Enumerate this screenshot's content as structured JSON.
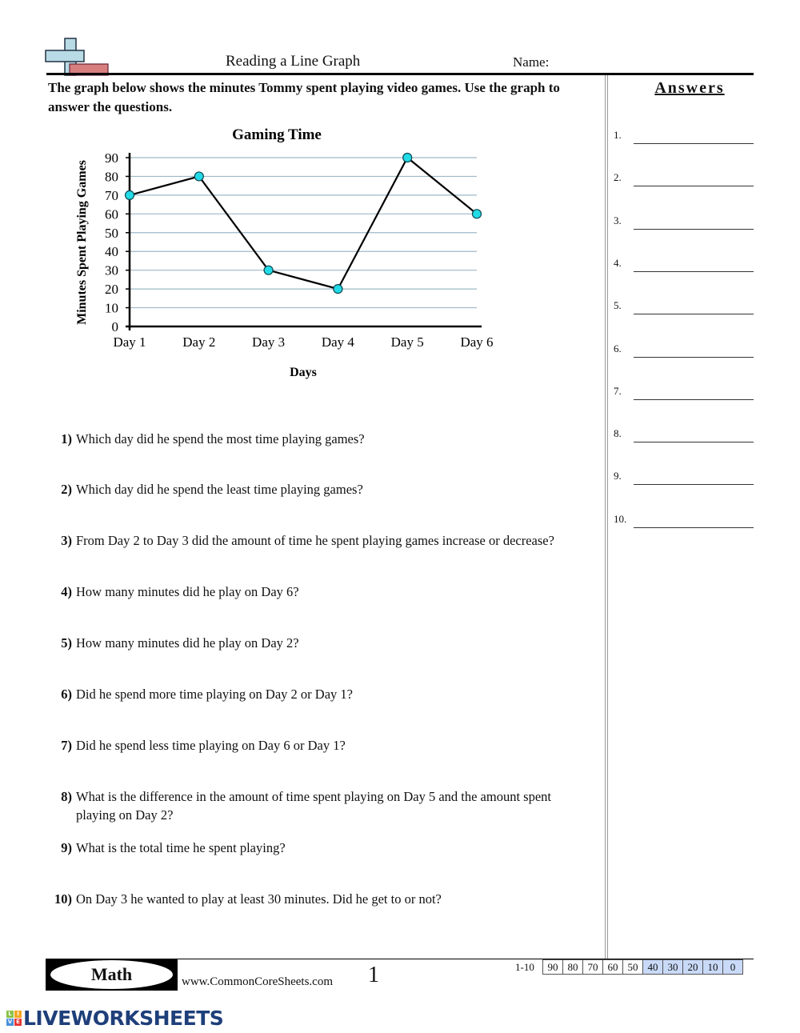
{
  "header": {
    "title": "Reading a Line Graph",
    "name_label": "Name:",
    "instructions": "The graph below shows the minutes Tommy spent playing video games. Use the graph to answer the questions."
  },
  "chart_data": {
    "type": "line",
    "title": "Gaming Time",
    "xlabel": "Days",
    "ylabel": "Minutes Spent Playing Games",
    "categories": [
      "Day 1",
      "Day 2",
      "Day 3",
      "Day 4",
      "Day 5",
      "Day 6"
    ],
    "series": [
      {
        "name": "Minutes",
        "values": [
          70,
          80,
          30,
          20,
          90,
          60
        ]
      }
    ],
    "ylim": [
      0,
      90
    ],
    "yticks": [
      0,
      10,
      20,
      30,
      40,
      50,
      60,
      70,
      80,
      90
    ],
    "grid": true,
    "legend": "none",
    "colors": {
      "marker": "#22dbe6",
      "line": "#000000",
      "grid": "#9fb8c8"
    }
  },
  "questions": [
    {
      "num": "1)",
      "text": "Which day did he spend the most time playing games?"
    },
    {
      "num": "2)",
      "text": "Which day did he spend the least time playing games?"
    },
    {
      "num": "3)",
      "text": "From Day 2 to Day 3 did the amount of time he spent playing games increase or decrease?"
    },
    {
      "num": "4)",
      "text": "How many minutes did he play on Day 6?"
    },
    {
      "num": "5)",
      "text": "How many minutes did he play on Day 2?"
    },
    {
      "num": "6)",
      "text": "Did he spend more time playing on Day 2 or Day 1?"
    },
    {
      "num": "7)",
      "text": "Did he spend less time playing on Day 6 or Day 1?"
    },
    {
      "num": "8)",
      "text": "What is the difference in the amount of time spent playing on Day 5 and the amount spent playing on Day 2?"
    },
    {
      "num": "9)",
      "text": "What is the total time he spent playing?"
    },
    {
      "num": "10)",
      "text": "On Day 3 he wanted to play at least 30 minutes. Did he get to or not?"
    }
  ],
  "answers": {
    "title": "Answers",
    "labels": [
      "1.",
      "2.",
      "3.",
      "4.",
      "5.",
      "6.",
      "7.",
      "8.",
      "9.",
      "10."
    ],
    "values": [
      "",
      "",
      "",
      "",
      "",
      "",
      "",
      "",
      "",
      ""
    ]
  },
  "footer": {
    "badge": "Math",
    "site": "www.CommonCoreSheets.com",
    "page": "1",
    "score_range": "1-10",
    "scores": [
      "90",
      "80",
      "70",
      "60",
      "50",
      "40",
      "30",
      "20",
      "10",
      "0"
    ],
    "highlight_color": "#c9daf8"
  },
  "branding": {
    "logo_letters": [
      "L",
      "I",
      "V",
      "E"
    ],
    "logo_colors": [
      "#8bc34a",
      "#f5a623",
      "#4a90d9",
      "#e53935"
    ],
    "text": "LIVEWORKSHEETS"
  }
}
